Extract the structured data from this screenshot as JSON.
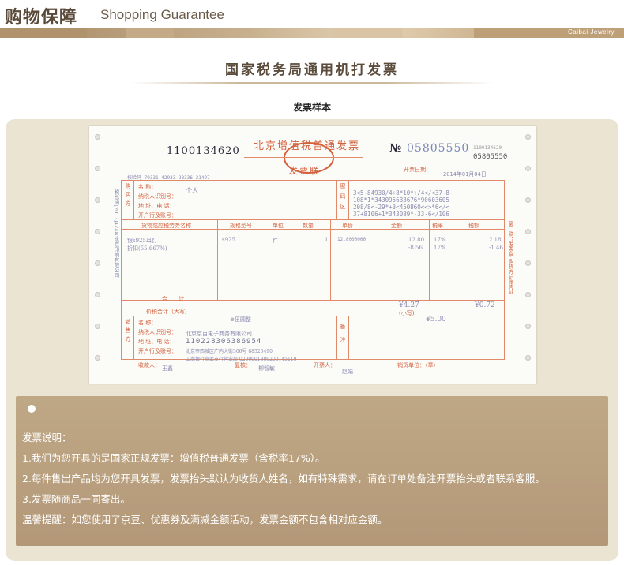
{
  "header": {
    "title_zh": "购物保障",
    "title_en": "Shopping Guarantee",
    "brand": "Caibai Jewelry"
  },
  "section": {
    "title": "国家税务局通用机打发票",
    "subtitle": "发票样本"
  },
  "invoice": {
    "code": "1100134620",
    "heading": "北京增值税普通发票",
    "stamp_text": "发票联",
    "no_symbol": "№",
    "number": "05805550",
    "number_small": "05805550",
    "code_small": "1100134620",
    "issue_date_label": "开票日期：",
    "issue_date": "2014年01月04日",
    "check_code": "校验码 79331 42933 23336 31497",
    "buyer": {
      "name_label": "名 称：",
      "name_value": "个人",
      "tax_id_label": "纳税人识别号：",
      "address_label": "地 址、电 话：",
      "bank_label": "开户行及账号："
    },
    "side_buyer": "购买方",
    "cipher_label": "密码区",
    "cipher_lines": [
      "3<5-84930/4+8*10*+/4</<37-8",
      "108*1*343095633676*90603605",
      "208/8<-29*+3<450860<<>*6</<",
      "37+8106+1*343089*-33-6</106"
    ],
    "columns": [
      "货物或应税劳务名称",
      "规格型号",
      "单位",
      "数量",
      "单价",
      "金额",
      "税率",
      "税额"
    ],
    "items": [
      {
        "name": "银s925耳钉",
        "spec": "s925",
        "unit": "件",
        "qty": "1",
        "price": "12.8000000",
        "amount": "12.80",
        "rate": "17%",
        "tax": "2.18"
      },
      {
        "name": "折扣(55.667%)",
        "spec": "",
        "unit": "",
        "qty": "",
        "price": "",
        "amount": "-8.56",
        "rate": "17%",
        "tax": "-1.46"
      }
    ],
    "total_label": "合 计",
    "total_amount": "¥4.27",
    "total_tax": "¥0.72",
    "grand_total_label": "价税合计（大写）",
    "grand_total_words": "⊗伍圆整",
    "grand_total_small_label": "(小写)",
    "grand_total_small": "¥5.00",
    "seller": {
      "name_label": "名 称：",
      "name_value": "北京京百电子商务有限公司",
      "tax_id_label": "纳税人识别号：",
      "tax_id_value": "110228306386954",
      "address_label": "地 址、电 话：",
      "address_value": "北京市西城区广内大街306号 88520490",
      "bank_label": "开户行及账号：",
      "bank_value": "工商银行宣武支行营业部 0200001809200145110"
    },
    "side_seller": "销售方",
    "remarks_label": "备注",
    "payee_label": "收款人：",
    "payee": "王鑫",
    "reviewer_label": "复核：",
    "reviewer": "柳智敏",
    "issuer_label": "开票人：",
    "issuer": "赵娟",
    "seller_stamp_label": "销货单位：（章）",
    "side_right": "第二联：发票联 购货方记账凭证",
    "side_left": "税总函[2013]474号北京印刷有限公司"
  },
  "notes": {
    "heading": "发票说明：",
    "lines": [
      "1.我们为您开具的是国家正规发票：增值税普通发票（含税率17%）。",
      "2.每件售出产品均为您开具发票，发票抬头默认为收货人姓名，如有特殊需求，请在订单处备注开票抬头或者联系客服。",
      "3.发票随商品一同寄出。",
      "温馨提醒：如您使用了京豆、优惠券及满减金额活动，发票金额不包含相对应金额。"
    ]
  }
}
